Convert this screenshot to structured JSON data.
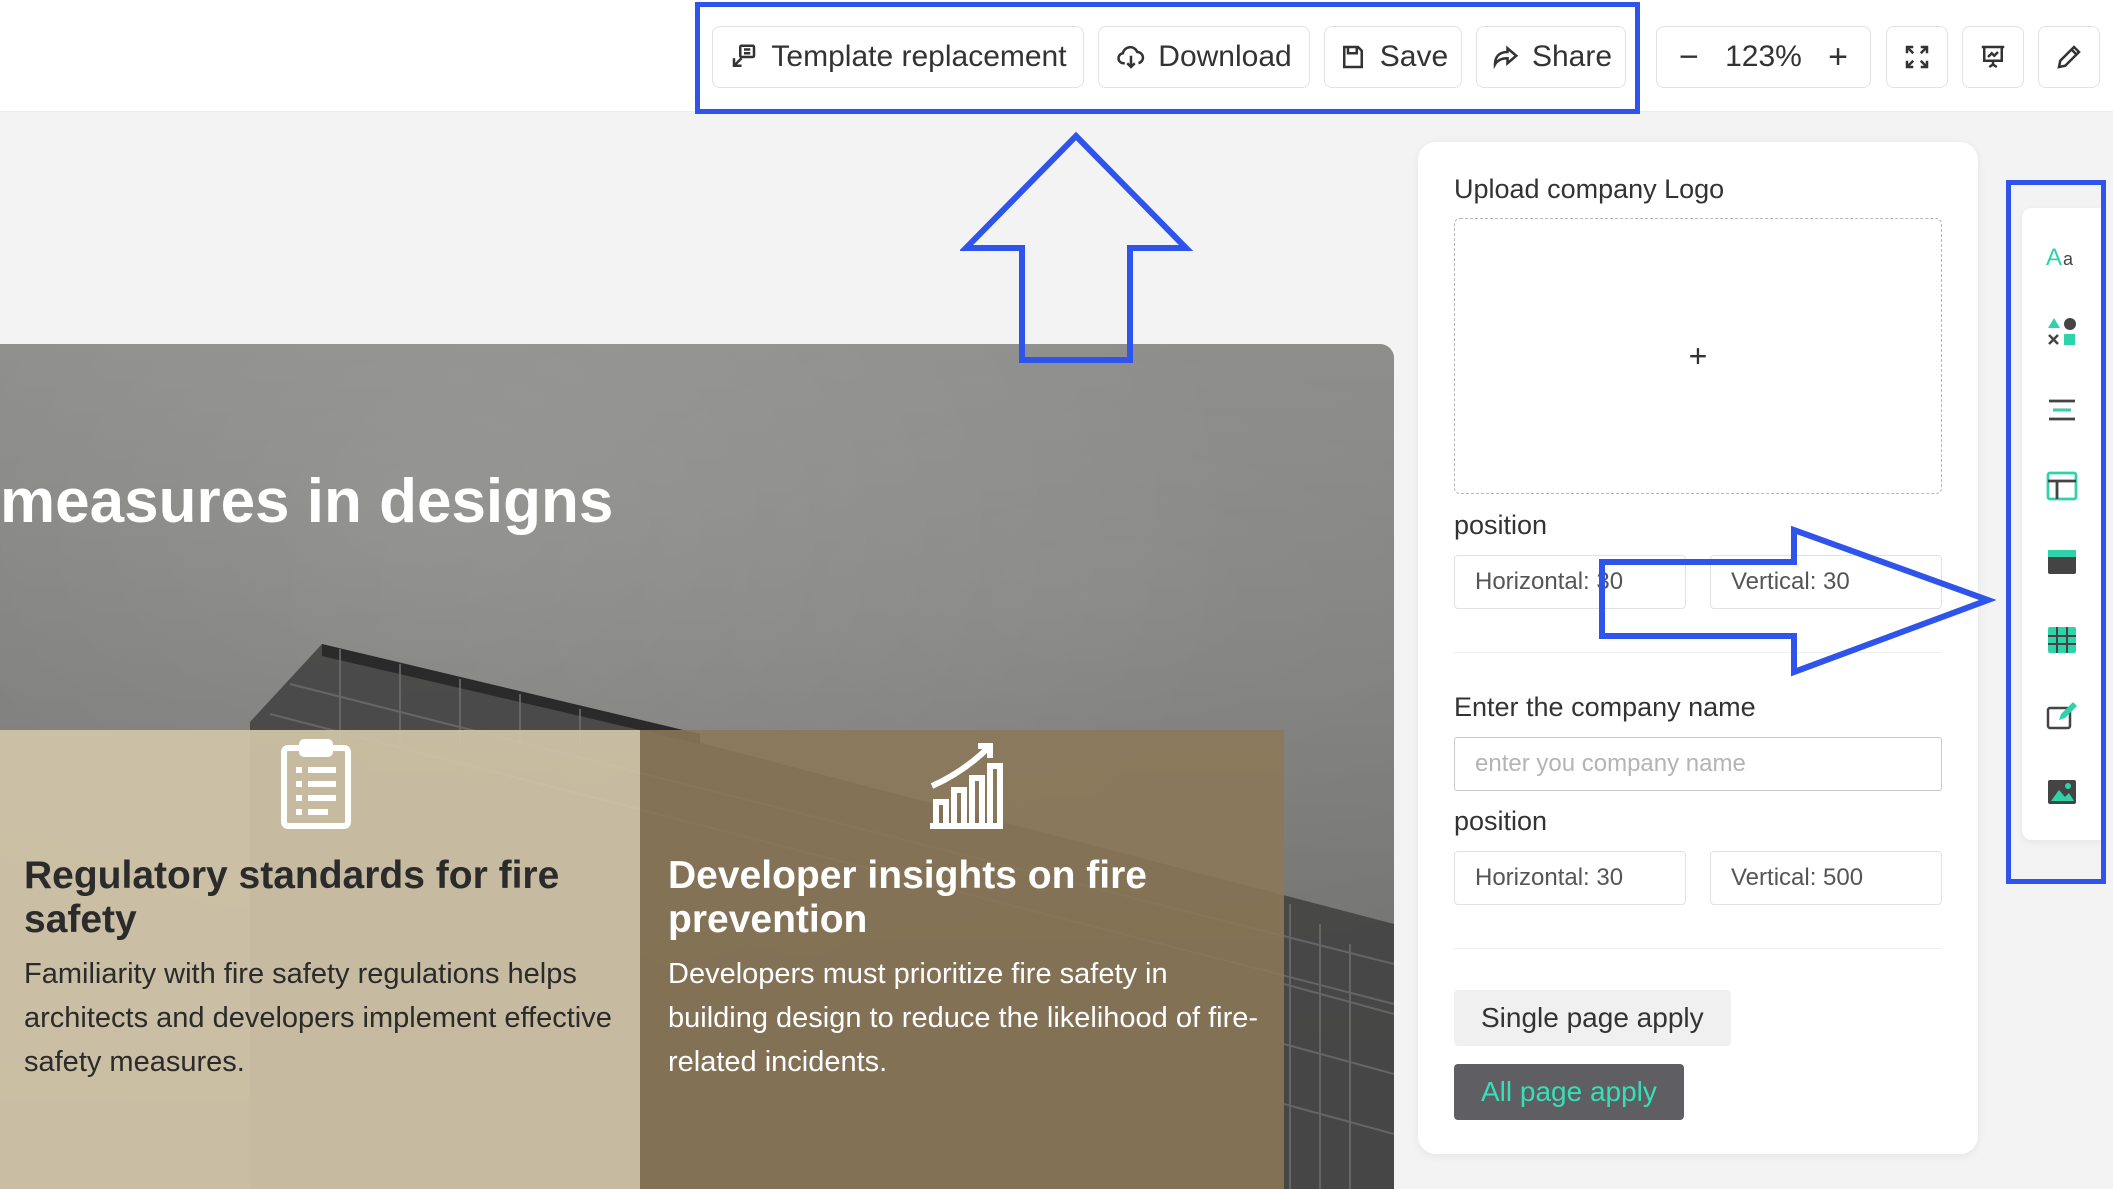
{
  "toolbar": {
    "template_label": "Template replacement",
    "download_label": "Download",
    "save_label": "Save",
    "share_label": "Share",
    "zoom_minus": "−",
    "zoom_value": "123%",
    "zoom_plus": "+"
  },
  "slide": {
    "title": "measures in designs",
    "cards": [
      {
        "title": "Regulatory standards for fire safety",
        "body": "Familiarity with fire safety regulations helps architects and developers implement effective safety measures."
      },
      {
        "title": "Developer insights on fire prevention",
        "body": "Developers must prioritize fire safety in building design to reduce the likelihood of fire-related incidents."
      }
    ]
  },
  "panel": {
    "logo_label": "Upload company Logo",
    "upload_plus": "+",
    "position_label": "position",
    "logo_horizontal": "Horizontal: 30",
    "logo_vertical": "Vertical: 30",
    "company_name_label": "Enter the company name",
    "company_name_placeholder": "enter you company name",
    "name_position_label": "position",
    "name_horizontal": "Horizontal: 30",
    "name_vertical": "Vertical: 500",
    "single_apply": "Single page apply",
    "all_apply": "All page apply"
  },
  "colors": {
    "accent": "#34e0b8",
    "annotation": "#2f54eb"
  },
  "sidebar_icons": [
    "text-icon",
    "shapes-icon",
    "align-icon",
    "layout-icon",
    "background-icon",
    "table-icon",
    "edit-icon",
    "image-icon"
  ]
}
